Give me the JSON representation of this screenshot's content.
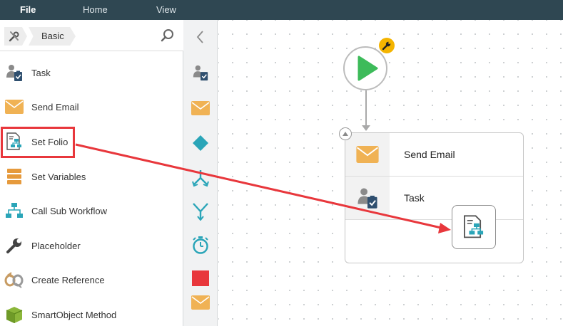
{
  "menu": {
    "file": "File",
    "home": "Home",
    "view": "View"
  },
  "toolbox": {
    "breadcrumb": {
      "category": "Basic"
    },
    "items": [
      {
        "label": "Task",
        "icon": "task-icon"
      },
      {
        "label": "Send Email",
        "icon": "email-icon"
      },
      {
        "label": "Set Folio",
        "icon": "set-folio-icon"
      },
      {
        "label": "Set Variables",
        "icon": "variables-icon"
      },
      {
        "label": "Call Sub Workflow",
        "icon": "sub-workflow-icon"
      },
      {
        "label": "Placeholder",
        "icon": "wrench-icon"
      },
      {
        "label": "Create Reference",
        "icon": "reference-icon"
      },
      {
        "label": "SmartObject Method",
        "icon": "smartobject-icon"
      }
    ]
  },
  "canvas": {
    "step": {
      "rows": [
        {
          "label": "Send Email",
          "icon": "email-icon"
        },
        {
          "label": "Task",
          "icon": "task-icon"
        }
      ]
    }
  },
  "colors": {
    "menubar": "#2f4752",
    "start_green": "#3dbb5a",
    "email_orange": "#f0b254",
    "teal": "#2aa5b8",
    "highlight_red": "#e8373c",
    "badge_yellow": "#f4b400"
  }
}
